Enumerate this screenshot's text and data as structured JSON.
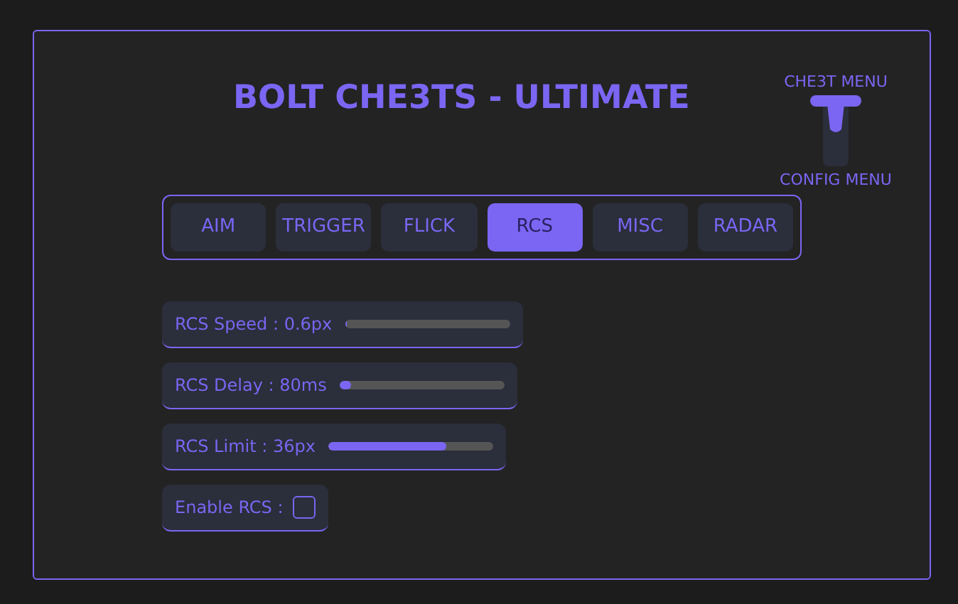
{
  "title": "BOLT CHE3TS - ULTIMATE",
  "menu_switch": {
    "top_label": "CHE3T MENU",
    "bottom_label": "CONFIG MENU",
    "at_top": true
  },
  "tabs": [
    {
      "label": "AIM",
      "selected": false
    },
    {
      "label": "TRIGGER",
      "selected": false
    },
    {
      "label": "FLICK",
      "selected": false
    },
    {
      "label": "RCS",
      "selected": true
    },
    {
      "label": "MISC",
      "selected": false
    },
    {
      "label": "RADAR",
      "selected": false
    }
  ],
  "settings": [
    {
      "kind": "slider",
      "label": "RCS Speed : 0.6px",
      "level": 0.01
    },
    {
      "kind": "slider",
      "label": "RCS Delay : 80ms",
      "level": 0.07
    },
    {
      "kind": "slider",
      "label": "RCS Limit : 36px",
      "level": 0.72
    },
    {
      "kind": "checkbox",
      "label": "Enable RCS :",
      "checked": false
    }
  ]
}
